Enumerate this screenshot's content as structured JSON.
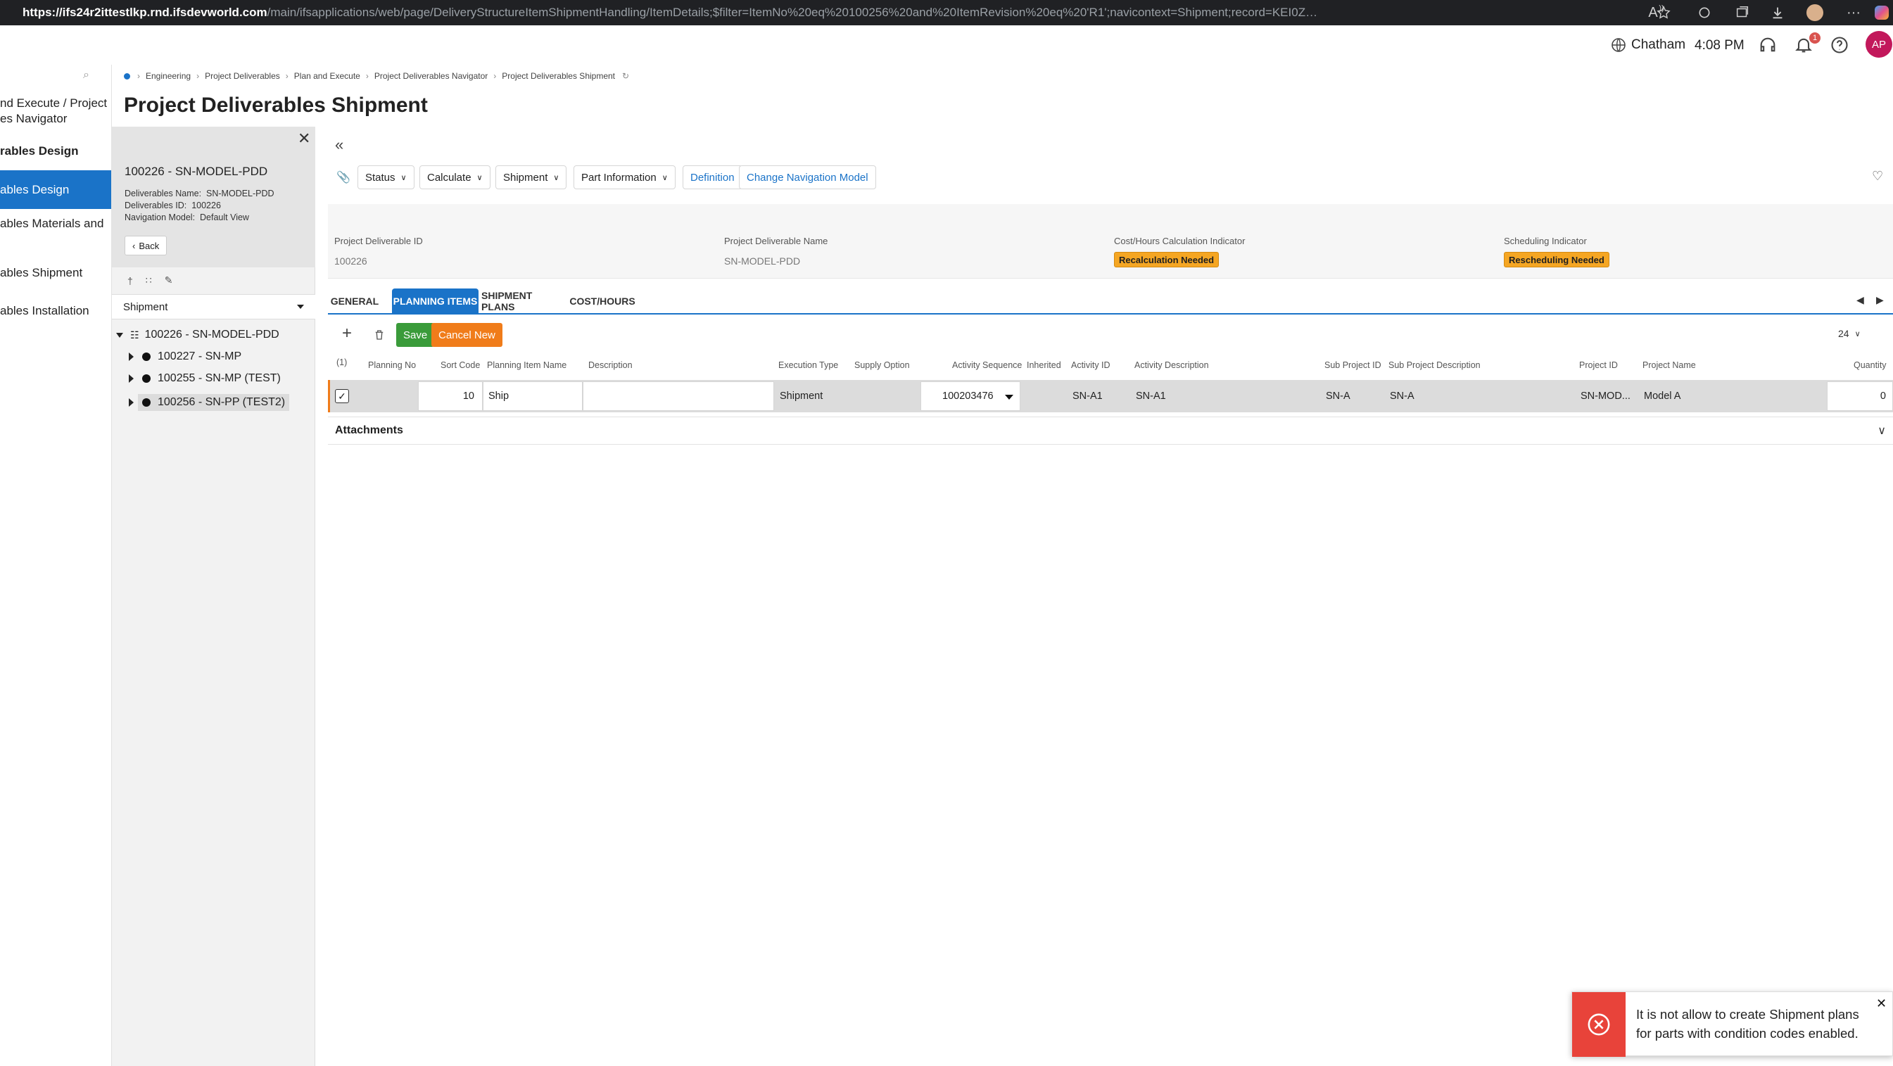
{
  "browser": {
    "url_host": "https://ifs24r2ittestlkp.rnd.ifsdevworld.com",
    "url_path": "/main/ifsapplications/web/page/DeliveryStructureItemShipmentHandling/ItemDetails;$filter=ItemNo%20eq%20100256%20and%20ItemRevision%20eq%20'R1';navicontext=Shipment;record=KEI0ZW1Obz0xMDAyMjYsSXRlbVJldmlzaW9uPSdSMScpL0RlbGl2ZXJ5SXRlbUNoaWxkQX..."
  },
  "header": {
    "location": "Chatham",
    "time": "4:08 PM",
    "notif_count": "1",
    "avatar": "AP"
  },
  "breadcrumb": [
    "Engineering",
    "Project Deliverables",
    "Plan and Execute",
    "Project Deliverables Navigator",
    "Project Deliverables Shipment"
  ],
  "page_title": "Project Deliverables Shipment",
  "leftnav": {
    "items": [
      {
        "label": "nd Execute / Project"
      },
      {
        "label": "es Navigator"
      },
      {
        "label": "rables Design"
      },
      {
        "label": "ables Design"
      },
      {
        "label": "ables Materials and"
      },
      {
        "label": "ables Shipment"
      },
      {
        "label": "ables Installation"
      }
    ]
  },
  "panel": {
    "title": "100226 - SN-MODEL-PDD",
    "name_label": "Deliverables Name:",
    "name_value": "SN-MODEL-PDD",
    "id_label": "Deliverables ID:",
    "id_value": "100226",
    "nav_label": "Navigation Model:",
    "nav_value": "Default View",
    "back": "Back",
    "select_value": "Shipment",
    "tree": [
      {
        "label": "100226 - SN-MODEL-PDD"
      },
      {
        "label": "100227 - SN-MP"
      },
      {
        "label": "100255 - SN-MP (TEST)"
      },
      {
        "label": "100256 - SN-PP (TEST2)"
      }
    ]
  },
  "toolbar": {
    "status": "Status",
    "calculate": "Calculate",
    "shipment": "Shipment",
    "part_info": "Part Information",
    "definition": "Definition",
    "change_nav": "Change Navigation Model"
  },
  "fields": {
    "pd_id_label": "Project Deliverable ID",
    "pd_id_value": "100226",
    "pd_name_label": "Project Deliverable Name",
    "pd_name_value": "SN-MODEL-PDD",
    "cost_label": "Cost/Hours Calculation Indicator",
    "cost_value": "Recalculation Needed",
    "sched_label": "Scheduling Indicator",
    "sched_value": "Rescheduling Needed"
  },
  "tabs": [
    {
      "label": "GENERAL"
    },
    {
      "label": "PLANNING ITEMS"
    },
    {
      "label": "SHIPMENT PLANS"
    },
    {
      "label": "COST/HOURS"
    }
  ],
  "grid": {
    "save": "Save",
    "cancel": "Cancel New",
    "page_size": "24",
    "selected_count": "(1)",
    "columns": [
      "Planning No",
      "Sort Code",
      "Planning Item Name",
      "Description",
      "Execution Type",
      "Supply Option",
      "Activity Sequence",
      "Inherited",
      "Activity ID",
      "Activity Description",
      "Sub Project ID",
      "Sub Project Description",
      "Project ID",
      "Project Name",
      "Quantity"
    ],
    "row": {
      "planning_no": "",
      "sort_code": "10",
      "item_name": "Ship",
      "description": "",
      "execution_type": "Shipment",
      "supply_option": "",
      "activity_sequence": "100203476",
      "inherited": "",
      "activity_id": "SN-A1",
      "activity_description": "SN-A1",
      "sub_project_id": "SN-A",
      "sub_project_description": "SN-A",
      "project_id": "SN-MOD...",
      "project_name": "Model A",
      "quantity": "0"
    }
  },
  "attachments": "Attachments",
  "toast": {
    "message": "It is not allow to create Shipment plans for parts with condition codes enabled."
  },
  "colors": {
    "accent": "#1a73c8",
    "save": "#3a9b3a",
    "cancel": "#f07c1a",
    "badge": "#f5a623",
    "error": "#e8433a"
  }
}
